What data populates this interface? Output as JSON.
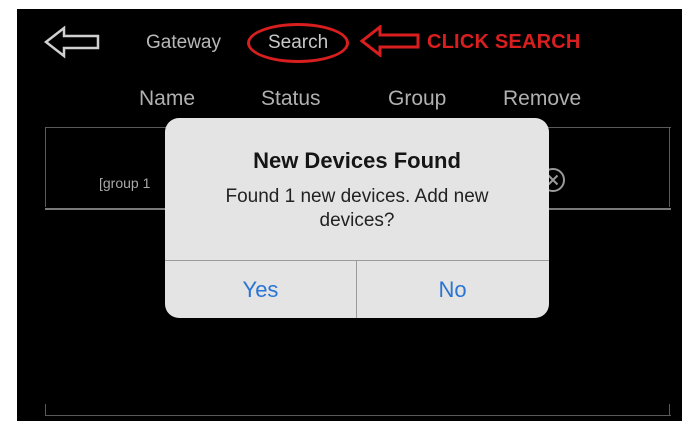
{
  "nav": {
    "gateway_label": "Gateway",
    "search_label": "Search"
  },
  "annotation": {
    "text": "CLICK SEARCH",
    "color": "#d81e1e"
  },
  "table": {
    "columns": [
      "Name",
      "Status",
      "Group",
      "Remove"
    ],
    "rows": [
      {
        "group": "[group 1"
      }
    ]
  },
  "dialog": {
    "title": "New Devices Found",
    "message": "Found 1 new devices. Add new devices?",
    "yes_label": "Yes",
    "no_label": "No",
    "button_color": "#2a74d4"
  },
  "icons": {
    "back": "back-arrow-icon",
    "remove": "remove-circle-icon"
  }
}
